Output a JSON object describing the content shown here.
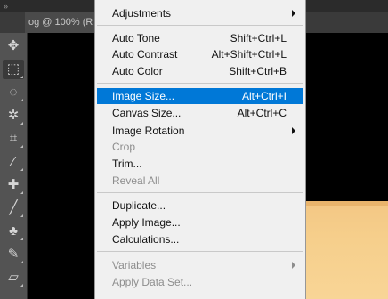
{
  "document_tab": {
    "title": "og @ 100% (R"
  },
  "toolbar": {
    "collapse_glyph": "»",
    "tools": [
      {
        "name": "move-icon",
        "glyph": "✥"
      },
      {
        "name": "marquee-icon",
        "glyph": "⬚"
      },
      {
        "name": "lasso-icon",
        "glyph": "◌"
      },
      {
        "name": "magic-wand-icon",
        "glyph": "✲"
      },
      {
        "name": "crop-icon",
        "glyph": "⌗"
      },
      {
        "name": "eyedropper-icon",
        "glyph": "⁄"
      },
      {
        "name": "healing-brush-icon",
        "glyph": "✚"
      },
      {
        "name": "brush-icon",
        "glyph": "╱"
      },
      {
        "name": "clone-stamp-icon",
        "glyph": "♣"
      },
      {
        "name": "history-brush-icon",
        "glyph": "✎"
      },
      {
        "name": "eraser-icon",
        "glyph": "▱"
      }
    ]
  },
  "menu": {
    "adjustments": {
      "label": "Adjustments"
    },
    "auto_tone": {
      "label": "Auto Tone",
      "shortcut": "Shift+Ctrl+L"
    },
    "auto_contrast": {
      "label": "Auto Contrast",
      "shortcut": "Alt+Shift+Ctrl+L"
    },
    "auto_color": {
      "label": "Auto Color",
      "shortcut": "Shift+Ctrl+B"
    },
    "image_size": {
      "label": "Image Size...",
      "shortcut": "Alt+Ctrl+I"
    },
    "canvas_size": {
      "label": "Canvas Size...",
      "shortcut": "Alt+Ctrl+C"
    },
    "image_rotation": {
      "label": "Image Rotation"
    },
    "crop": {
      "label": "Crop"
    },
    "trim": {
      "label": "Trim..."
    },
    "reveal_all": {
      "label": "Reveal All"
    },
    "duplicate": {
      "label": "Duplicate..."
    },
    "apply_image": {
      "label": "Apply Image..."
    },
    "calculations": {
      "label": "Calculations..."
    },
    "variables": {
      "label": "Variables"
    },
    "apply_data_set": {
      "label": "Apply Data Set..."
    }
  },
  "colors": {
    "menu_highlight": "#0078d7",
    "menu_background": "#f0f0f0",
    "toolbar_background": "#535353",
    "canvas_gradient": "#f6cf8c"
  }
}
